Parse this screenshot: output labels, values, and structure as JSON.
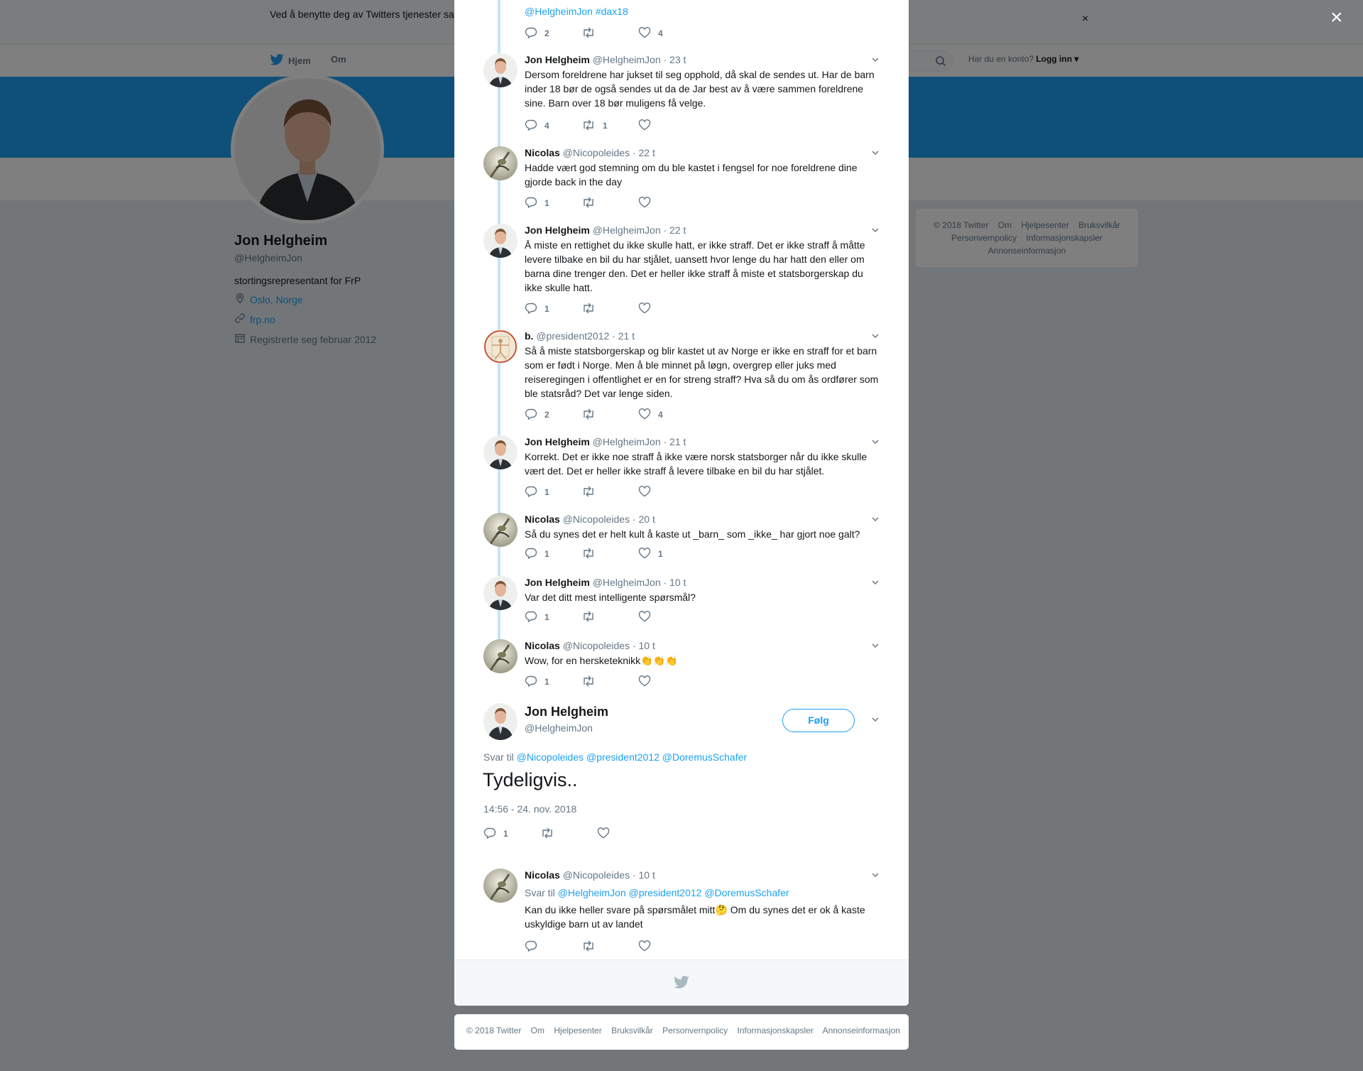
{
  "cookie_banner": {
    "text": "Ved å benytte deg av Twitters tjenester sa… informasjonskapsler til bl.a. analyser, personalisering og annonser.",
    "close": "×"
  },
  "nav": {
    "home": "Hjem",
    "about": "Om",
    "login_prompt": "Har du en konto?",
    "login": "Logg inn"
  },
  "profile": {
    "name": "Jon Helgheim",
    "handle": "@HelgheimJon",
    "bio": "stortingsrepresentant for FrP",
    "location": "Oslo, Norge",
    "website": "frp.no",
    "joined": "Registrerte seg februar 2012"
  },
  "right_footer_links": [
    "© 2018 Twitter",
    "Om",
    "Hjelpesenter",
    "Bruksvilkår",
    "Personvernpolicy",
    "Informasjonskapsler",
    "Annonseinformasjon"
  ],
  "overlay_close": "×",
  "colors": {
    "accent": "#1da1f2",
    "thread": "#c4e4f8",
    "muted": "#657786"
  },
  "top_partial": {
    "mention": "@HelgheimJon",
    "hashtag": "#dax18",
    "replies": "2",
    "retweets": "",
    "likes": "4"
  },
  "tweets": [
    {
      "name": "Jon Helgheim",
      "handle": "@HelgheimJon",
      "time": "· 23 t",
      "text": "Dersom foreldrene har jukset til seg opphold, då skal de sendes ut. Har de barn inder 18 bør de også sendes ut da de Jar best av å være sammen foreldrene sine. Barn over 18 bør muligens få velge.",
      "replies": "4",
      "retweets": "1",
      "likes": ""
    },
    {
      "name": "Nicolas",
      "handle": "@Nicopoleides",
      "time": "· 22 t",
      "text": "Hadde vært god stemning om du ble kastet i fengsel for noe foreldrene dine gjorde back in the day",
      "replies": "1",
      "retweets": "",
      "likes": ""
    },
    {
      "name": "Jon Helgheim",
      "handle": "@HelgheimJon",
      "time": "· 22 t",
      "text": "Å miste en rettighet du ikke skulle hatt, er ikke straff. Det er ikke straff å måtte levere tilbake en bil du har stjålet, uansett hvor lenge du har hatt den eller om barna dine trenger den. Det er heller ikke straff å miste et statsborgerskap du ikke skulle hatt.",
      "replies": "1",
      "retweets": "",
      "likes": ""
    },
    {
      "name": "b.",
      "handle": "@president2012",
      "time": "· 21 t",
      "text": "Så å miste statsborgerskap og blir kastet ut av Norge er ikke en straff for et barn som er født i Norge. Men å ble minnet på løgn, overgrep eller juks med reiseregingen i offentlighet er en for streng straff?  Hva så du om ås ordfører som ble statsråd? Det var lenge siden.",
      "replies": "2",
      "retweets": "",
      "likes": "4"
    },
    {
      "name": "Jon Helgheim",
      "handle": "@HelgheimJon",
      "time": "· 21 t",
      "text": "Korrekt. Det er ikke noe straff å ikke være norsk statsborger når du ikke skulle vært det. Det er heller ikke straff å levere tilbake en bil du har stjålet.",
      "replies": "1",
      "retweets": "",
      "likes": ""
    },
    {
      "name": "Nicolas",
      "handle": "@Nicopoleides",
      "time": "· 20 t",
      "text": "Så du synes det er helt kult å kaste ut _barn_ som _ikke_ har gjort noe galt?",
      "replies": "1",
      "retweets": "",
      "likes": "1"
    },
    {
      "name": "Jon Helgheim",
      "handle": "@HelgheimJon",
      "time": "· 10 t",
      "text": "Var det ditt mest intelligente spørsmål?",
      "replies": "1",
      "retweets": "",
      "likes": ""
    },
    {
      "name": "Nicolas",
      "handle": "@Nicopoleides",
      "time": "· 10 t",
      "text": "Wow, for en hersketeknikk👏👏👏",
      "replies": "1",
      "retweets": "",
      "likes": ""
    }
  ],
  "main_tweet": {
    "name": "Jon Helgheim",
    "handle": "@HelgheimJon",
    "follow": "Følg",
    "reply_to_label": "Svar til",
    "reply_to": "@Nicopoleides @president2012 @DoremusSchafer",
    "text": "Tydeligvis..",
    "datetime": "14:56 - 24. nov. 2018",
    "replies": "1",
    "retweets": "",
    "likes": ""
  },
  "reply_tweet": {
    "name": "Nicolas",
    "handle": "@Nicopoleides",
    "time": "· 10 t",
    "reply_to_label": "Svar til",
    "reply_to": "@HelgheimJon @president2012 @DoremusSchafer",
    "text": "Kan du ikke heller svare på spørsmålet mitt🤔  Om du synes det er ok å kaste uskyldige barn ut av landet",
    "replies": "",
    "retweets": "",
    "likes": ""
  },
  "bottom_footer_links": [
    "© 2018 Twitter",
    "Om",
    "Hjelpesenter",
    "Bruksvilkår",
    "Personvernpolicy",
    "Informasjonskapsler",
    "Annonseinformasjon"
  ]
}
